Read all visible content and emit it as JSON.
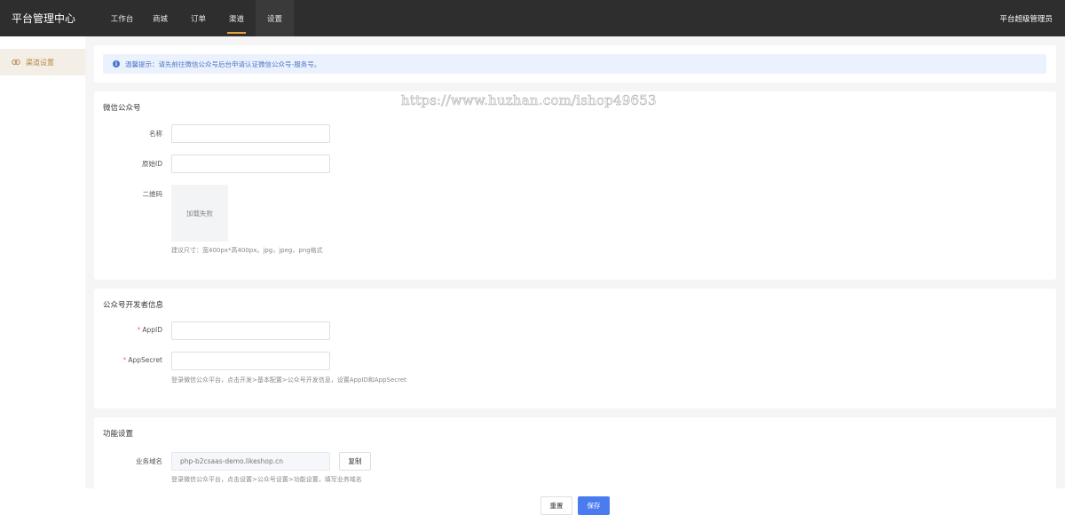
{
  "header": {
    "brand": "平台管理中心",
    "nav": [
      {
        "label": "工作台"
      },
      {
        "label": "商城"
      },
      {
        "label": "订单"
      },
      {
        "label": "渠道"
      },
      {
        "label": "设置"
      }
    ],
    "active_nav": "渠道",
    "admin_name": "平台超级管理员"
  },
  "sidebar": {
    "items": [
      {
        "label": "渠道设置",
        "icon": "channel-icon"
      }
    ]
  },
  "tip": {
    "icon": "info-icon",
    "text": "温馨提示：请先前往微信公众号后台申请认证微信公众号-服务号。"
  },
  "wechat": {
    "title": "微信公众号",
    "name_label": "名称",
    "name_value": "",
    "origin_id_label": "原始ID",
    "origin_id_value": "",
    "qrcode_label": "二维码",
    "qrcode_status": "加载失败",
    "qrcode_hint": "建议尺寸：宽400px*高400px。jpg，jpeg，png格式"
  },
  "developer": {
    "title": "公众号开发者信息",
    "required_mark": "*",
    "appid_label": "AppID",
    "appid_value": "",
    "appsecret_label": "AppSecret",
    "appsecret_value": "",
    "hint": "登录微信公众平台，点击开发>基本配置>公众号开发信息，设置AppID和AppSecret"
  },
  "function": {
    "title": "功能设置",
    "domain_label": "业务域名",
    "domain_value": "php-b2csaas-demo.likeshop.cn",
    "copy_label": "复制",
    "hint": "登录微信公众平台，点击设置>公众号设置>功能设置，填写业务域名"
  },
  "footer": {
    "reset_label": "重置",
    "save_label": "保存"
  },
  "watermark": "https://www.huzhan.com/ishop49653",
  "colors": {
    "topbar": "#2e2e2e",
    "accent": "#e6a23c",
    "primary": "#4a7cf0",
    "tip_bg": "#ecf2fd"
  }
}
